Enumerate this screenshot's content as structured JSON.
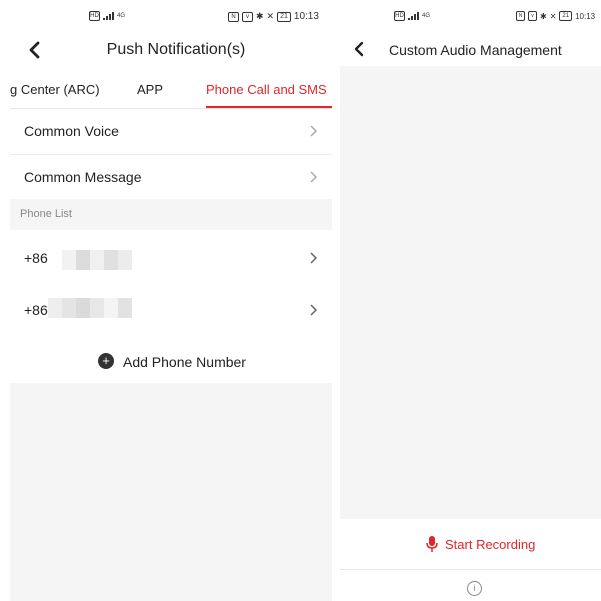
{
  "left_screen": {
    "status": {
      "time": "10:13",
      "battery": "21",
      "network": "4G"
    },
    "title": "Push Notification(s)",
    "tabs": [
      {
        "label": "g Center (ARC)"
      },
      {
        "label": "APP"
      },
      {
        "label": "Phone Call and SMS",
        "active": true
      }
    ],
    "rows": [
      {
        "label": "Common Voice"
      },
      {
        "label": "Common Message"
      }
    ],
    "section_label": "Phone List",
    "phones": [
      {
        "prefix": "+86"
      },
      {
        "prefix": "+86"
      }
    ],
    "add_label": "Add Phone Number",
    "colors": {
      "accent": "#e0252b",
      "background_gray": "#f5f5f5"
    }
  },
  "right_screen": {
    "status": {
      "time": "10:13",
      "battery": "21",
      "network": "4G"
    },
    "title": "Custom Audio Management",
    "record_label": "Start Recording",
    "info_icon": "info-icon"
  }
}
